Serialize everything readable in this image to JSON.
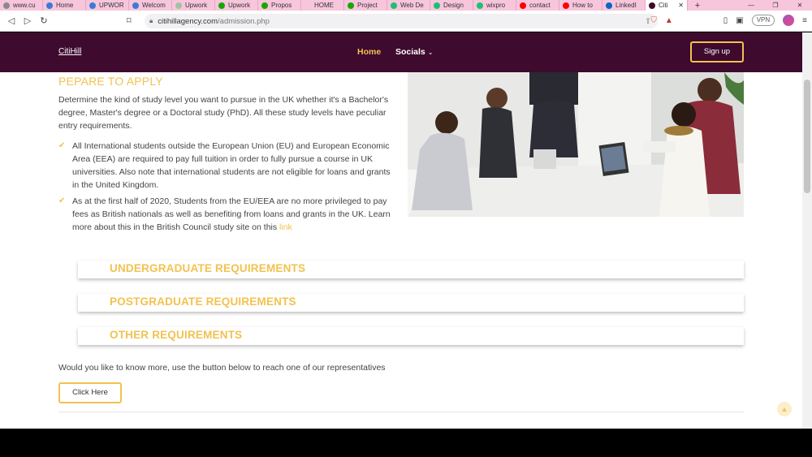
{
  "browser": {
    "tabs": [
      {
        "label": "www.cu",
        "color": "#8a8a8a"
      },
      {
        "label": "Home",
        "color": "#3a7bd5"
      },
      {
        "label": "UPWOR",
        "color": "#3a7bd5"
      },
      {
        "label": "Welcom",
        "color": "#3a7bd5"
      },
      {
        "label": "Upwork",
        "color": "#a0c4a0"
      },
      {
        "label": "Upwork",
        "color": "#14a800"
      },
      {
        "label": "Propos",
        "color": "#14a800"
      },
      {
        "label": "HOME",
        "color": "#f7c6dc"
      },
      {
        "label": "Project",
        "color": "#14a800"
      },
      {
        "label": "Web De",
        "color": "#1dbf73"
      },
      {
        "label": "Design",
        "color": "#1dbf73"
      },
      {
        "label": "wixpro",
        "color": "#1dbf73"
      },
      {
        "label": "contact",
        "color": "#ff0000"
      },
      {
        "label": "How to",
        "color": "#ff0000"
      },
      {
        "label": "LinkedI",
        "color": "#0a66c2"
      },
      {
        "label": "Citi",
        "color": "#3e0a2e"
      }
    ],
    "url_domain": "citihillagency.com",
    "url_path": "/admission.php",
    "vpn_label": "VPN"
  },
  "site": {
    "brand": "CitiHill",
    "nav": {
      "home": "Home",
      "socials": "Socials"
    },
    "signup_label": "Sign up",
    "section_title": "PEPARE TO APPLY",
    "intro": "Determine the kind of study level you want to pursue in the UK whether it's a Bachelor's degree, Master's degree or a Doctoral study (PhD). All these study levels have peculiar entry requirements.",
    "bullets": [
      "All International students outside the European Union (EU) and European Economic Area (EEA) are required to pay full tuition in order to fully pursue a course in UK universities. Also note that international students are not eligible for loans and grants in the United Kingdom.",
      "As at the first half of 2020, Students from the EU/EEA are no more privileged to pay fees as British nationals as well as benefiting from loans and grants in the UK. Learn more about this in the British Council study site on this"
    ],
    "bullet_link": "link",
    "accordions": [
      "UNDERGRADUATE REQUIREMENTS",
      "POSTGRADUATE REQUIREMENTS",
      "OTHER REQUIREMENTS"
    ],
    "more_text": "Would you like to know more, use the button below to reach one of our representatives",
    "click_label": "Click Here"
  },
  "colors": {
    "brand_dark": "#3e0a2e",
    "accent": "#f2c24f"
  }
}
